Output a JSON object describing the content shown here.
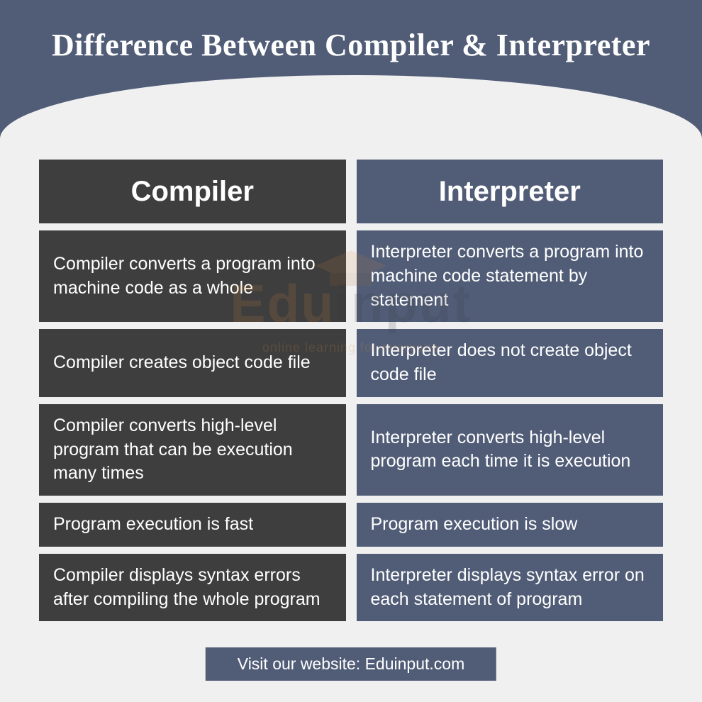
{
  "chart_data": {
    "type": "table",
    "title": "Difference Between Compiler & Interpreter",
    "columns": [
      "Compiler",
      "Interpreter"
    ],
    "rows": [
      [
        "Compiler converts a program into machine code as a whole",
        "Interpreter converts a program into machine code statement by statement"
      ],
      [
        "Compiler creates object code file",
        "Interpreter does not create object code file"
      ],
      [
        "Compiler converts high-level program that can be execution many times",
        "Interpreter converts high-level program each time it is execution"
      ],
      [
        "Program execution is fast",
        "Program execution is slow"
      ],
      [
        "Compiler displays syntax errors after compiling the whole program",
        "Interpreter displays syntax error on each statement of program"
      ]
    ]
  },
  "title": "Difference Between Compiler & Interpreter",
  "columns": {
    "left": "Compiler",
    "right": "Interpreter"
  },
  "rows": [
    {
      "left": "Compiler converts a program into machine code as a whole",
      "right": "Interpreter converts a program into machine code statement by statement"
    },
    {
      "left": "Compiler creates object code file",
      "right": "Interpreter does not create object code file"
    },
    {
      "left": "Compiler converts high-level program that can be execution many times",
      "right": "Interpreter converts high-level program each time it is execution"
    },
    {
      "left": "Program execution is fast",
      "right": "Program execution is slow"
    },
    {
      "left": "Compiler displays syntax errors after compiling the whole program",
      "right": "Interpreter displays syntax error on each statement of program"
    }
  ],
  "footer": "Visit our website: Eduinput.com",
  "watermark": {
    "part1": "Edu",
    "part2": "input",
    "sub": "online learning for everyone"
  }
}
